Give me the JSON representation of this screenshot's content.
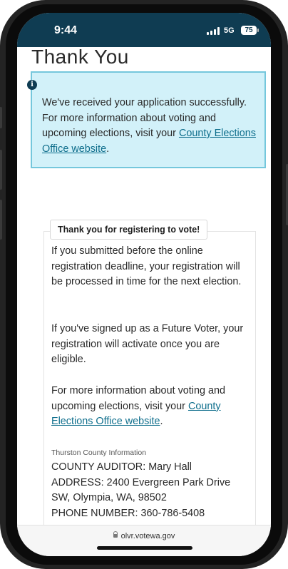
{
  "status_bar": {
    "time": "9:44",
    "network": "5G",
    "battery": "75"
  },
  "page": {
    "title": "Thank You"
  },
  "alert": {
    "icon": "info-icon",
    "text_before_link": "We've received your application successfully. For more information about voting and upcoming elections, visit your ",
    "link_text": "County Elections Office website",
    "text_after_link": "."
  },
  "card": {
    "tag": "Thank you for registering to vote!",
    "para1": "If you submitted before the online registration deadline, your registration will be processed in time for the next election.",
    "para2": "If you've signed up as a Future Voter, your registration will activate once you are eligible.",
    "para3_before_link": "For more information about voting and upcoming elections, visit your ",
    "para3_link": "County Elections Office website",
    "para3_after_link": ".",
    "county_label": "Thurston County Information",
    "auditor": "COUNTY AUDITOR: Mary Hall",
    "address": "ADDRESS: 2400 Evergreen Park Drive SW, Olympia, WA, 98502",
    "phone": "PHONE NUMBER: 360-786-5408"
  },
  "url_bar": {
    "url": "olvr.votewa.gov"
  },
  "colors": {
    "status_bar": "#0f3c52",
    "alert_bg": "#d2f1f9",
    "alert_border": "#75c7dc",
    "link": "#0e6e8c"
  }
}
